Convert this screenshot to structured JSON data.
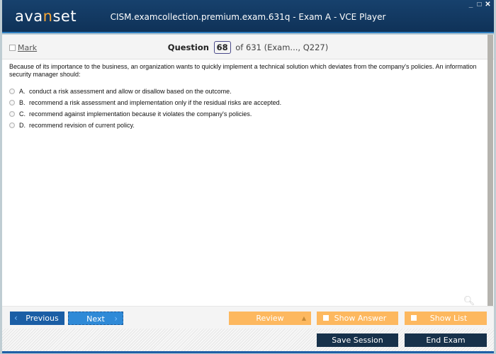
{
  "window": {
    "logo_prefix": "ava",
    "logo_accent": "n",
    "logo_suffix": "set",
    "title": "CISM.examcollection.premium.exam.631q - Exam A - VCE Player",
    "controls": {
      "minimize": "_",
      "maximize": "□",
      "close": "✕"
    }
  },
  "header": {
    "mark_label": "Mark",
    "mark_checked": false,
    "question_label": "Question",
    "question_number": "68",
    "question_rest": "of 631 (Exam..., Q227)"
  },
  "question": {
    "text": "Because of its importance to the business, an organization wants to quickly implement a technical solution which deviates from the company's policies. An information security manager should:",
    "options": [
      {
        "letter": "A.",
        "text": "conduct a risk assessment and allow or disallow based on the outcome."
      },
      {
        "letter": "B.",
        "text": "recommend a risk assessment and implementation only if the residual risks are accepted."
      },
      {
        "letter": "C.",
        "text": "recommend against implementation because it violates the company's policies."
      },
      {
        "letter": "D.",
        "text": "recommend revision of current policy."
      }
    ]
  },
  "zoom": {
    "search_icon": "search-icon",
    "plus": "+",
    "minus": "−"
  },
  "nav": {
    "previous": "Previous",
    "next": "Next",
    "review": "Review",
    "show_answer": "Show Answer",
    "show_list": "Show List",
    "save_session": "Save Session",
    "end_exam": "End Exam"
  },
  "colors": {
    "title_bar": "#17416d",
    "accent_orange": "#fdb85f",
    "button_blue": "#1b5ea5",
    "button_dark": "#17314a"
  }
}
